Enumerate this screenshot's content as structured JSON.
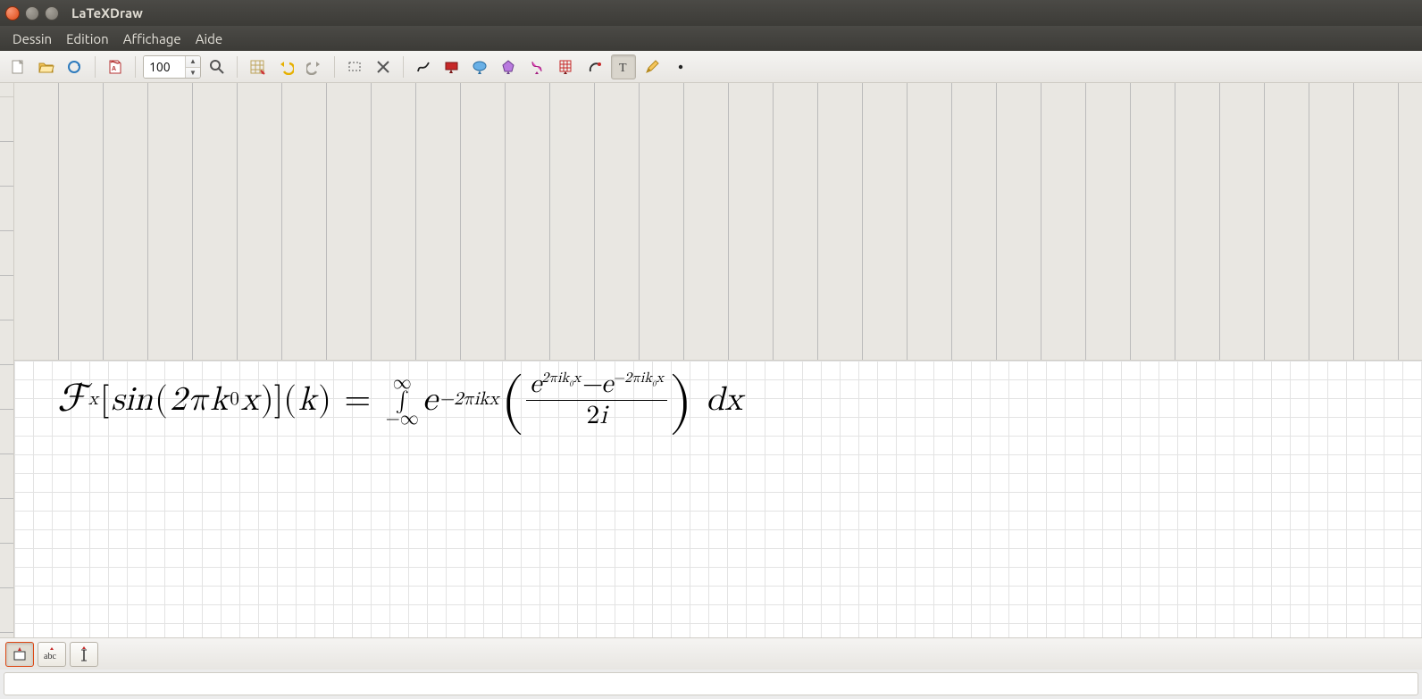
{
  "window": {
    "title": "LaTeXDraw"
  },
  "menu": {
    "items": [
      "Dessin",
      "Edition",
      "Affichage",
      "Aide"
    ]
  },
  "toolbar": {
    "zoom_value": "100",
    "icons": {
      "new": "new-doc-icon",
      "open": "open-folder-icon",
      "reload": "reload-icon",
      "pdf": "pdf-export-icon",
      "zoom": "zoom-icon",
      "grid": "grid-icon",
      "undo": "undo-icon",
      "redo": "redo-icon",
      "select": "selection-rect-icon",
      "delete": "delete-icon",
      "freehand": "freehand-icon",
      "rect": "rectangle-tool-icon",
      "ellipse": "ellipse-tool-icon",
      "polygon": "polygon-tool-icon",
      "bezier": "bezier-tool-icon",
      "gridshape": "grid-shape-icon",
      "arc": "arc-tool-icon",
      "text": "text-tool-icon",
      "pencil": "pencil-icon",
      "dot": "dot-tool-icon"
    }
  },
  "canvas": {
    "formula_latex": "\\mathcal{F}_x[\\sin(2\\pi k_0 x)](k) = \\int_{-\\infty}^{\\infty} e^{-2\\pi i k x} \\left( \\frac{e^{2\\pi i k_0 x} - e^{-2\\pi i k_0 x}}{2i} \\right) dx"
  },
  "bottom": {
    "toggles": [
      "frame-toggle",
      "abc-toggle",
      "cursor-toggle"
    ]
  },
  "status": {
    "text": ""
  }
}
